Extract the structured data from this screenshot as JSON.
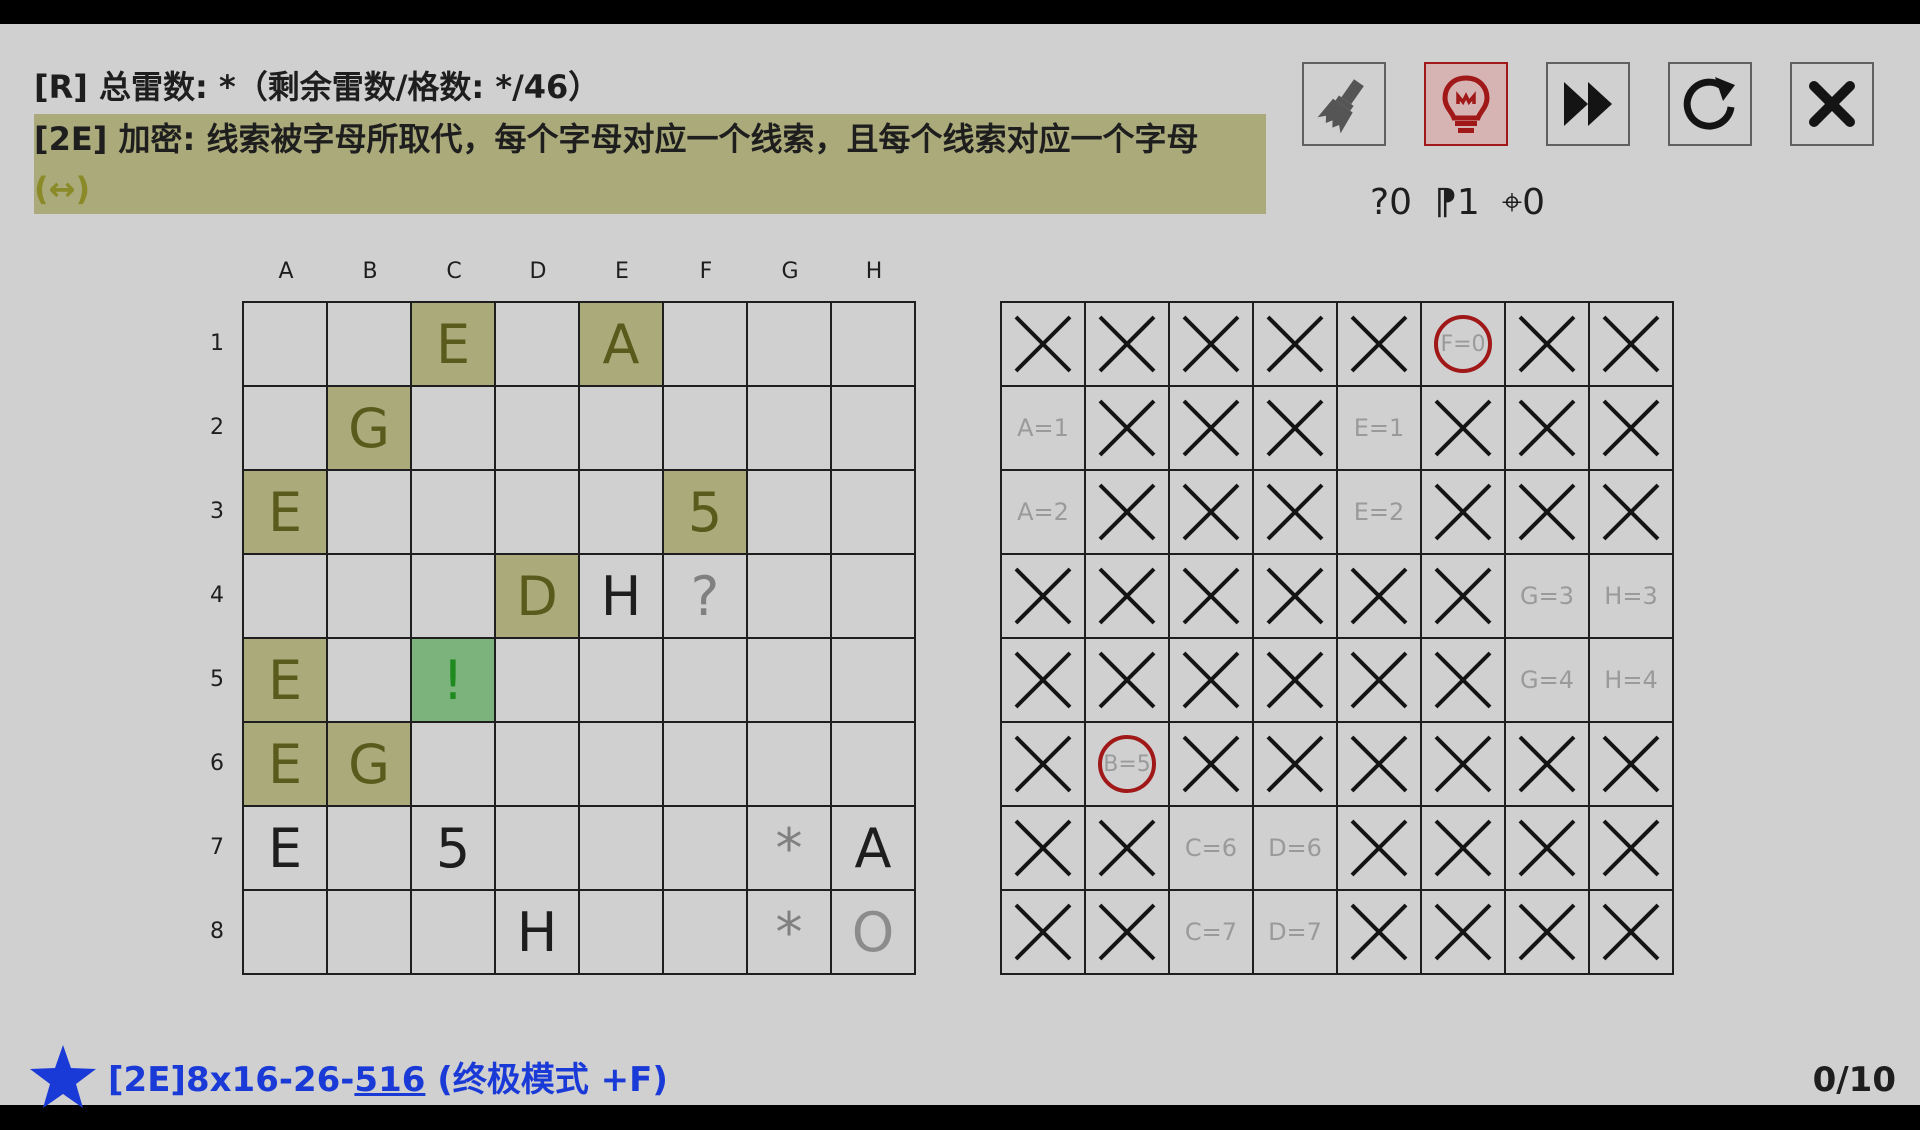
{
  "rules": {
    "line1": "[R] 总雷数: *（剩余雷数/格数: */46）",
    "line2_text": "[2E] 加密: 线索被字母所取代，每个字母对应一个线索，且每个线索对应一个字母 ",
    "line2_arrow": "(↔)"
  },
  "toolbar": {
    "buttons": [
      {
        "name": "brush-button",
        "icon": "brush-icon"
      },
      {
        "name": "hint-button",
        "icon": "lightbulb-icon"
      },
      {
        "name": "skip-button",
        "icon": "fast-forward-icon"
      },
      {
        "name": "restart-button",
        "icon": "restart-icon"
      },
      {
        "name": "close-button",
        "icon": "close-icon"
      }
    ],
    "colors": {
      "hint_border": "#a01818",
      "hint_bg": "#d7b4b4"
    }
  },
  "counters": {
    "question": "?0",
    "flag": "⁋1",
    "mine": "⌖0"
  },
  "left_grid": {
    "columns": [
      "A",
      "B",
      "C",
      "D",
      "E",
      "F",
      "G",
      "H"
    ],
    "rows": [
      "1",
      "2",
      "3",
      "4",
      "5",
      "6",
      "7",
      "8"
    ],
    "cells": [
      [
        {
          "t": ""
        },
        {
          "t": ""
        },
        {
          "t": "E",
          "k": "clue"
        },
        {
          "t": ""
        },
        {
          "t": "A",
          "k": "clue"
        },
        {
          "t": ""
        },
        {
          "t": ""
        },
        {
          "t": ""
        }
      ],
      [
        {
          "t": ""
        },
        {
          "t": "G",
          "k": "clue"
        },
        {
          "t": ""
        },
        {
          "t": ""
        },
        {
          "t": ""
        },
        {
          "t": ""
        },
        {
          "t": ""
        },
        {
          "t": ""
        }
      ],
      [
        {
          "t": "E",
          "k": "clue"
        },
        {
          "t": ""
        },
        {
          "t": ""
        },
        {
          "t": ""
        },
        {
          "t": ""
        },
        {
          "t": "5",
          "k": "clue"
        },
        {
          "t": ""
        },
        {
          "t": ""
        }
      ],
      [
        {
          "t": ""
        },
        {
          "t": ""
        },
        {
          "t": ""
        },
        {
          "t": "D",
          "k": "clue"
        },
        {
          "t": "H"
        },
        {
          "t": "?",
          "k": "q"
        },
        {
          "t": ""
        },
        {
          "t": ""
        }
      ],
      [
        {
          "t": "E",
          "k": "clue"
        },
        {
          "t": ""
        },
        {
          "t": "!",
          "k": "safe"
        },
        {
          "t": ""
        },
        {
          "t": ""
        },
        {
          "t": ""
        },
        {
          "t": ""
        },
        {
          "t": ""
        }
      ],
      [
        {
          "t": "E",
          "k": "clue"
        },
        {
          "t": "G",
          "k": "clue"
        },
        {
          "t": ""
        },
        {
          "t": ""
        },
        {
          "t": ""
        },
        {
          "t": ""
        },
        {
          "t": ""
        },
        {
          "t": ""
        }
      ],
      [
        {
          "t": "E"
        },
        {
          "t": ""
        },
        {
          "t": "5"
        },
        {
          "t": ""
        },
        {
          "t": ""
        },
        {
          "t": ""
        },
        {
          "t": "*",
          "k": "star"
        },
        {
          "t": "A"
        }
      ],
      [
        {
          "t": ""
        },
        {
          "t": ""
        },
        {
          "t": ""
        },
        {
          "t": "H"
        },
        {
          "t": ""
        },
        {
          "t": ""
        },
        {
          "t": "*",
          "k": "star"
        },
        {
          "t": "O",
          "k": "oh"
        }
      ]
    ]
  },
  "right_grid": {
    "cells": [
      [
        "X",
        "X",
        "X",
        "X",
        "X",
        "(F=0)",
        "X",
        "X"
      ],
      [
        "A=1",
        "X",
        "X",
        "X",
        "E=1",
        "X",
        "X",
        "X"
      ],
      [
        "A=2",
        "X",
        "X",
        "X",
        "E=2",
        "X",
        "X",
        "X"
      ],
      [
        "X",
        "X",
        "X",
        "X",
        "X",
        "X",
        "G=3",
        "H=3"
      ],
      [
        "X",
        "X",
        "X",
        "X",
        "X",
        "X",
        "G=4",
        "H=4"
      ],
      [
        "X",
        "(B=5)",
        "X",
        "X",
        "X",
        "X",
        "X",
        "X"
      ],
      [
        "X",
        "X",
        "C=6",
        "D=6",
        "X",
        "X",
        "X",
        "X"
      ],
      [
        "X",
        "X",
        "C=7",
        "D=7",
        "X",
        "X",
        "X",
        "X"
      ]
    ]
  },
  "footer": {
    "title_a": "[2E]8x16-26-",
    "title_b": "516",
    "title_c": " (终极模式 +F)",
    "score": "0/10",
    "title_color": "#1a3ad8"
  }
}
